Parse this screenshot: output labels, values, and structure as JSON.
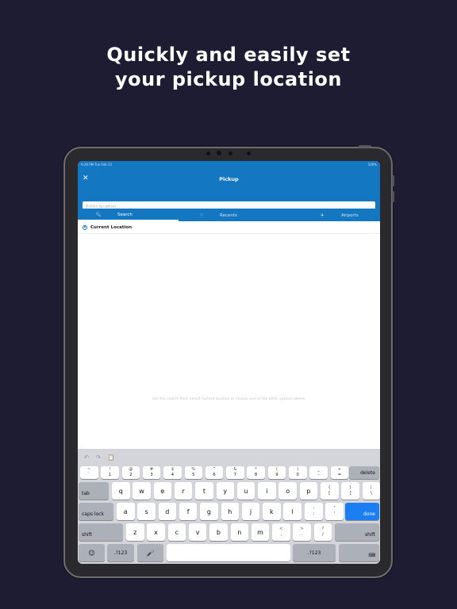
{
  "headline": {
    "line1": "Quickly and easily set",
    "line2": "your pickup location"
  },
  "status_bar": {
    "time": "9:26 PM  Tue Feb 23",
    "battery": "100%"
  },
  "nav": {
    "title": "Pickup",
    "close_icon": "close-icon"
  },
  "search": {
    "placeholder": "Enter location",
    "value": ""
  },
  "tabs": [
    {
      "label": "Search",
      "icon": "search-icon",
      "active": true
    },
    {
      "label": "Recents",
      "icon": "heart-icon",
      "active": false
    },
    {
      "label": "Airports",
      "icon": "airplane-icon",
      "active": false
    }
  ],
  "list": [
    {
      "label": "Current Location",
      "selected": true
    }
  ],
  "hint": "Use the search field, select current location or choose one of the other options above.",
  "keyboard": {
    "toolbar": {
      "undo": "↶",
      "redo": "↷",
      "paste": "📋"
    },
    "number_row": [
      {
        "top": "~",
        "bottom": "`"
      },
      {
        "top": "!",
        "bottom": "1"
      },
      {
        "top": "@",
        "bottom": "2"
      },
      {
        "top": "#",
        "bottom": "3"
      },
      {
        "top": "$",
        "bottom": "4"
      },
      {
        "top": "%",
        "bottom": "5"
      },
      {
        "top": "^",
        "bottom": "6"
      },
      {
        "top": "&",
        "bottom": "7"
      },
      {
        "top": "*",
        "bottom": "8"
      },
      {
        "top": "(",
        "bottom": "9"
      },
      {
        "top": ")",
        "bottom": "0"
      },
      {
        "top": "_",
        "bottom": "-"
      },
      {
        "top": "+",
        "bottom": "="
      }
    ],
    "delete": "delete",
    "tab": "tab",
    "row1": [
      "q",
      "w",
      "e",
      "r",
      "t",
      "y",
      "u",
      "i",
      "o",
      "p"
    ],
    "row1_sym": [
      {
        "top": "{",
        "bottom": "["
      },
      {
        "top": "}",
        "bottom": "]"
      },
      {
        "top": "|",
        "bottom": "\\"
      }
    ],
    "caps": "caps lock",
    "row2": [
      "a",
      "s",
      "d",
      "f",
      "g",
      "h",
      "j",
      "k",
      "l"
    ],
    "row2_sym": [
      {
        "top": ":",
        "bottom": ";"
      },
      {
        "top": "\"",
        "bottom": "'"
      }
    ],
    "done": "done",
    "shift": "shift",
    "row3": [
      "z",
      "x",
      "c",
      "v",
      "b",
      "n",
      "m"
    ],
    "row3_sym": [
      {
        "top": "<",
        "bottom": ","
      },
      {
        "top": ">",
        "bottom": "."
      },
      {
        "top": "?",
        "bottom": "/"
      }
    ],
    "emoji": "☺",
    "num_toggle": ".?123",
    "mic": "🎤",
    "space": "",
    "hide": "⌨"
  },
  "colors": {
    "background": "#1d1c33",
    "accent": "#1477c2",
    "done_key": "#1b7ff2"
  }
}
